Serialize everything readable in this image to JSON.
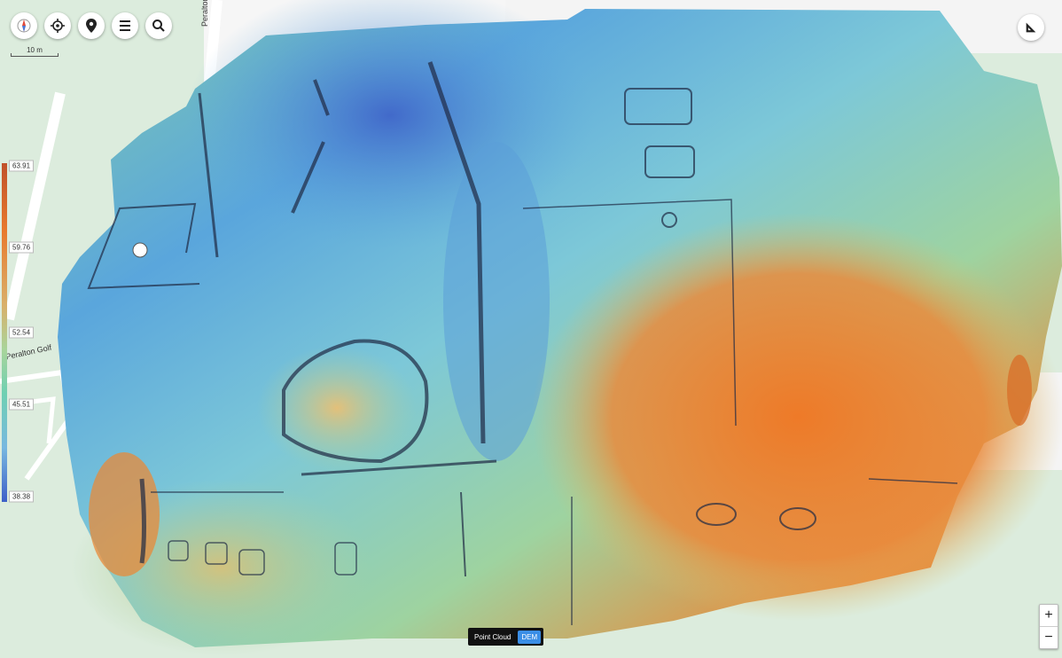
{
  "toolbar": {
    "buttons": [
      {
        "name": "compass-icon"
      },
      {
        "name": "crosshair-icon"
      },
      {
        "name": "map-pin-icon"
      },
      {
        "name": "layers-list-icon"
      },
      {
        "name": "search-icon"
      }
    ]
  },
  "scale": {
    "label": "10 m"
  },
  "legend": {
    "ticks": [
      {
        "label": "63.91",
        "fraction": 0.0
      },
      {
        "label": "59.76",
        "fraction": 0.25
      },
      {
        "label": "52.54",
        "fraction": 0.5
      },
      {
        "label": "45.51",
        "fraction": 0.72
      },
      {
        "label": "38.38",
        "fraction": 1.0
      }
    ],
    "colors": [
      "#c0502a",
      "#e87a2e",
      "#d9b06a",
      "#a9d49a",
      "#6fd0b2",
      "#78b8e0",
      "#3d5fc8"
    ]
  },
  "streets": {
    "top_label": "Peralton Blvd",
    "left_label": "Peralton Golf"
  },
  "view_toggle": {
    "point_cloud": "Point Cloud",
    "dem": "DEM",
    "active": "DEM"
  },
  "zoom": {
    "in": "+",
    "out": "−"
  },
  "measure": {
    "icon": "ruler-triangle-icon"
  }
}
